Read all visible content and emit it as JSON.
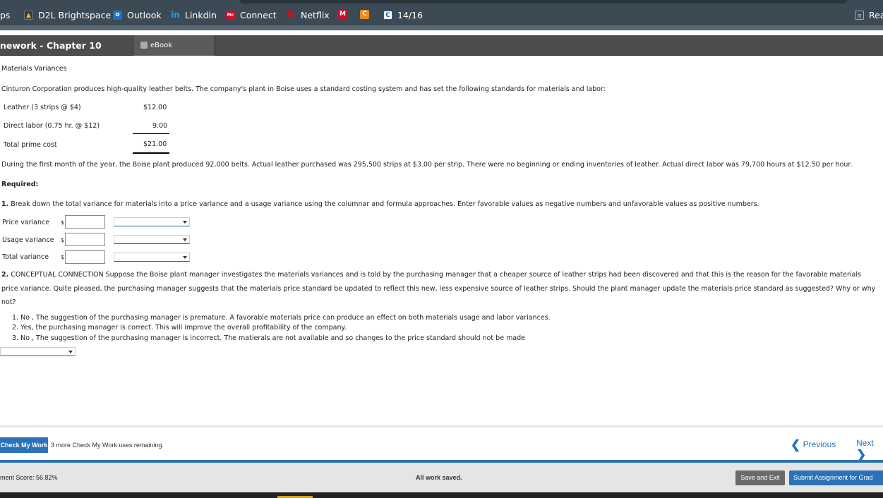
{
  "bookmarks": {
    "items": [
      {
        "label": "ps",
        "icon": "none"
      },
      {
        "label": "D2L Brightspace",
        "icon": "d2l-icon"
      },
      {
        "label": "Outlook",
        "icon": "outlook-icon"
      },
      {
        "label": "Linkdin",
        "icon": "linkedin-icon"
      },
      {
        "label": "Connect",
        "icon": "connect-icon"
      },
      {
        "label": "Netflix",
        "icon": "netflix-icon"
      },
      {
        "label": "",
        "icon": "m-icon"
      },
      {
        "label": "",
        "icon": "c-orange-icon"
      },
      {
        "label": "14/16",
        "icon": "c-blue-icon"
      }
    ],
    "reading_label": "Rea"
  },
  "tabs": {
    "title": "nework - Chapter 10",
    "ebook": "eBook"
  },
  "problem": {
    "heading": "Materials Variances",
    "intro": "Cinturon Corporation produces high-quality leather belts. The company's plant in Boise uses a standard costing system and has set the following standards for materials and labor:",
    "standards": [
      {
        "label": "Leather (3 strips @ $4)",
        "value": "$12.00"
      },
      {
        "label": "Direct labor (0.75 hr. @ $12)",
        "value": "9.00"
      },
      {
        "label": "Total prime cost",
        "value": "$21.00"
      }
    ],
    "during": "During the first month of the year, the Boise plant produced 92,000 belts. Actual leather purchased was 295,500 strips at $3.00 per strip. There were no beginning or ending inventories of leather. Actual direct labor was 79,700 hours at $12.50 per hour.",
    "required": "Required:",
    "q1": "Break down the total variance for materials into a price variance and a usage variance using the columnar and formula approaches. Enter favorable values as negative numbers and unfavorable values as positive numbers.",
    "q1_num": "1.",
    "variances": [
      {
        "label": "Price variance",
        "currency": "$",
        "value": "",
        "select": ""
      },
      {
        "label": "Usage variance",
        "currency": "$",
        "value": "",
        "select": ""
      },
      {
        "label": "Total variance",
        "currency": "$",
        "value": "",
        "select": ""
      }
    ],
    "q2_num": "2.",
    "q2_line1": "CONCEPTUAL CONNECTION Suppose the Boise plant manager investigates the materials variances and is told by the purchasing manager that a cheaper source of leather strips had been discovered and that this is the reason for the favorable materials",
    "q2_line2": "price variance. Quite pleased, the purchasing manager suggests that the materials price standard be updated to reflect this new, less expensive source of leather strips. Should the plant manager update the materials price standard as suggested? Why or why",
    "q2_line3": "not?",
    "options": [
      "1. No , The suggestion of the purchasing manager is premature. A favorable materials price can produce an effect on both materials usage and labor variances.",
      "2. Yes, the purchasing manager is correct. This will improve the overall profitability of the company.",
      "3. No , The suggestion of the purchasing manager is incorrect. The matierals are not available and so changes to the price standard should not be made"
    ],
    "answer_select": ""
  },
  "footer": {
    "check_button": "Check My Work",
    "check_note": "3 more Check My Work uses remaining.",
    "previous": "Previous",
    "next": "Next",
    "score": "ment Score: 56.82%",
    "saved": "All work saved.",
    "save_exit": "Save and Exit",
    "submit": "Submit Assignment for Grad"
  },
  "colors": {
    "accent": "#2c72b8",
    "bookmark_bar": "#3b4a54",
    "tab_bar": "#4d4d4d"
  }
}
